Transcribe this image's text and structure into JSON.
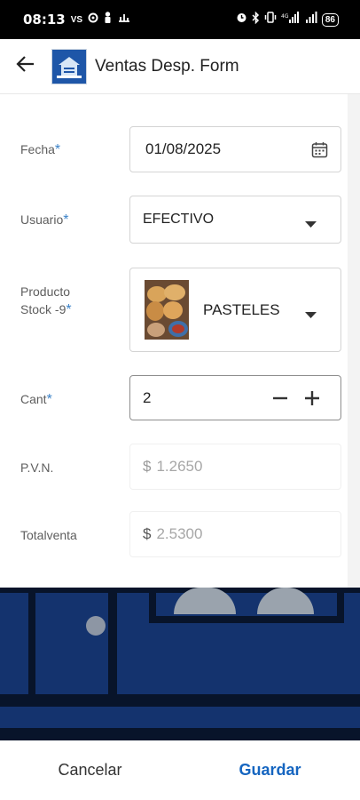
{
  "status_bar": {
    "time": "08:13",
    "left_icons": "VS",
    "battery": "86"
  },
  "app_bar": {
    "title": "Ventas Desp. Form"
  },
  "form": {
    "fecha": {
      "label": "Fecha",
      "required": "*",
      "value": "01/08/2025"
    },
    "usuario": {
      "label": "Usuario",
      "required": "*",
      "value": "EFECTIVO"
    },
    "producto": {
      "label_line1": "Producto",
      "label_line2": "Stock -9",
      "required": "*",
      "value": "PASTELES"
    },
    "cant": {
      "label": "Cant",
      "required": "*",
      "value": "2"
    },
    "pvn": {
      "label": "P.V.N.",
      "currency": "$",
      "value": "1.2650"
    },
    "totalventa": {
      "label": "Totalventa",
      "currency": "$",
      "value": "2.5300"
    }
  },
  "actions": {
    "cancel_label": "Cancelar",
    "save_label": "Guardar"
  },
  "colors": {
    "accent": "#1565c0",
    "required": "#3b82c8",
    "backdrop": "#14336e"
  }
}
